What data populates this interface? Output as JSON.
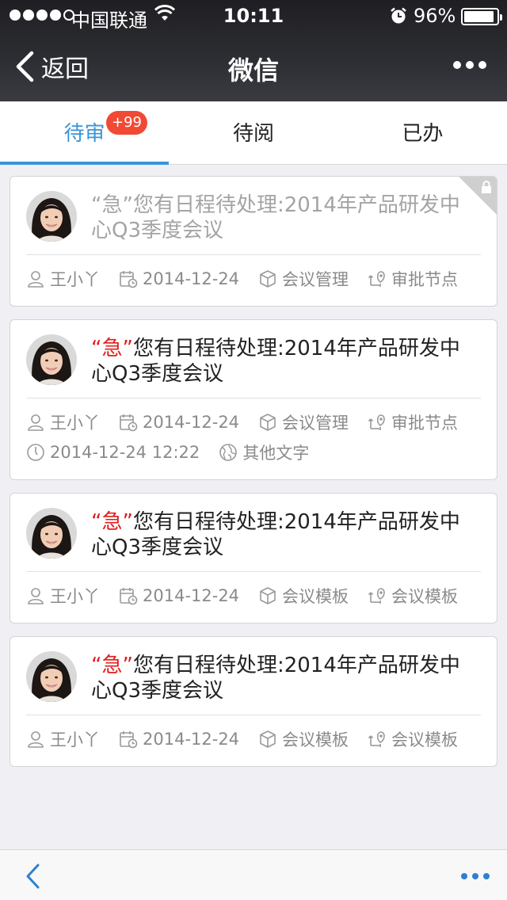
{
  "status_bar": {
    "carrier": "中国联通",
    "time": "10:11",
    "battery_percent": "96%",
    "battery_level": 0.96
  },
  "nav": {
    "back_label": "返回",
    "title": "微信"
  },
  "tabs": [
    {
      "label": "待审",
      "badge": "+99",
      "active": true
    },
    {
      "label": "待阅"
    },
    {
      "label": "已办"
    }
  ],
  "items": [
    {
      "urgent": "“急”",
      "title": "您有日程待处理:2014年产品研发中心Q3季度会议",
      "locked": true,
      "user": "王小丫",
      "date": "2014-12-24",
      "category": "会议管理",
      "node": "审批节点"
    },
    {
      "urgent": "“急”",
      "title": "您有日程待处理:2014年产品研发中心Q3季度会议",
      "user": "王小丫",
      "date": "2014-12-24",
      "category": "会议管理",
      "node": "审批节点",
      "datetime": "2014-12-24 12:22",
      "other": "其他文字"
    },
    {
      "urgent": "“急”",
      "title": "您有日程待处理:2014年产品研发中心Q3季度会议",
      "user": "王小丫",
      "date": "2014-12-24",
      "category": "会议模板",
      "node": "会议模板"
    },
    {
      "urgent": "“急”",
      "title": "您有日程待处理:2014年产品研发中心Q3季度会议",
      "user": "王小丫",
      "date": "2014-12-24",
      "category": "会议模板",
      "node": "会议模板"
    }
  ],
  "colors": {
    "accent": "#3a95d8",
    "urgent": "#e01d1d",
    "badge": "#f04a35"
  }
}
